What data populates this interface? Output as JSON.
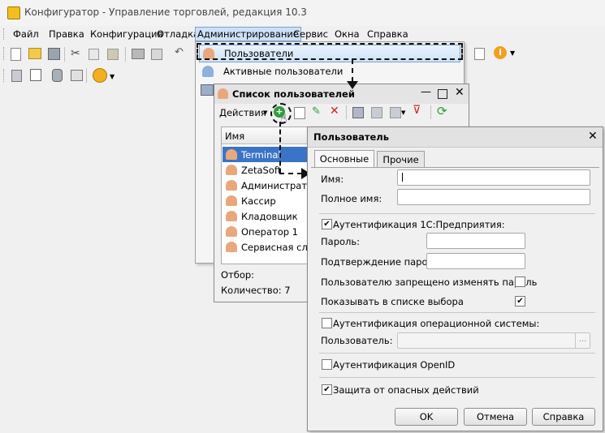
{
  "app": {
    "title": "Конфигуратор - Управление торговлей, редакция 10.3"
  },
  "menu": {
    "items": [
      "Файл",
      "Правка",
      "Конфигурация",
      "Отладка",
      "Администрирование",
      "Сервис",
      "Окна",
      "Справка"
    ]
  },
  "admin_menu": {
    "items": [
      "Пользователи",
      "Активные пользователи"
    ]
  },
  "user_list": {
    "title": "Список пользователей",
    "actions_label": "Действия",
    "column_header": "Имя",
    "users": [
      "Terminal",
      "ZetaSoft",
      "Администратор",
      "Кассир",
      "Кладовщик",
      "Оператор 1",
      "Сервисная слу..."
    ],
    "filter_label": "Отбор:",
    "count_label": "Количество: 7"
  },
  "user_dialog": {
    "title": "Пользователь",
    "tabs": [
      "Основные",
      "Прочие"
    ],
    "name_label": "Имя:",
    "full_name_label": "Полное имя:",
    "auth_1c_label": "Аутентификация 1С:Предприятия:",
    "password_label": "Пароль:",
    "confirm_password_label": "Подтверждение пароля:",
    "forbid_change_label": "Пользователю запрещено изменять пароль",
    "show_in_list_label": "Показывать в списке выбора",
    "os_auth_label": "Аутентификация операционной системы:",
    "os_user_label": "Пользователь:",
    "os_user_button": "...",
    "openid_label": "Аутентификация OpenID",
    "protection_label": "Защита от опасных действий",
    "ok_label": "OK",
    "cancel_label": "Отмена",
    "help_label": "Справка",
    "auth_1c_checked": true,
    "forbid_change_checked": false,
    "show_in_list_checked": true,
    "os_auth_checked": false,
    "openid_checked": false,
    "protection_checked": true
  },
  "colors": {
    "selection": "#3b74c7",
    "menu_highlight": "#cce0f7",
    "accent_green": "#2e9b3a",
    "delete_red": "#d02020"
  }
}
